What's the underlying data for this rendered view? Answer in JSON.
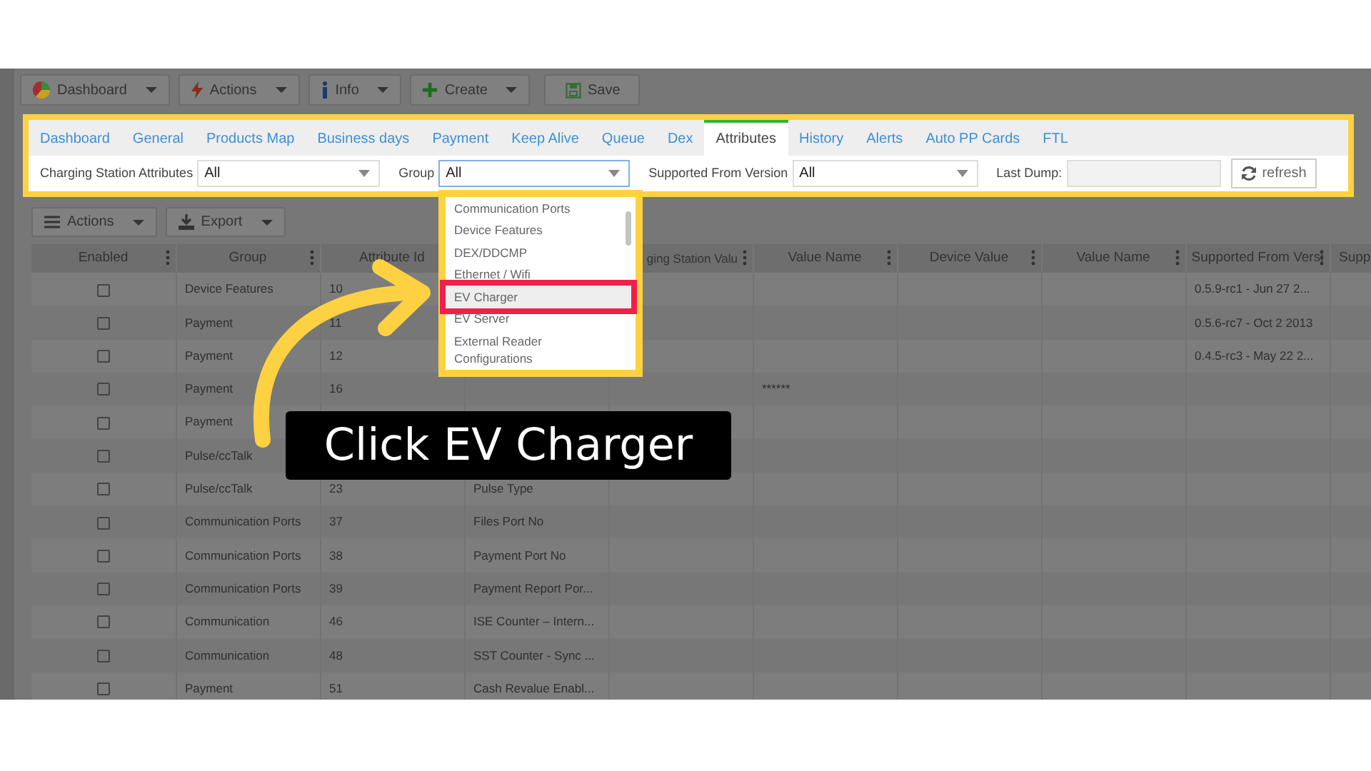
{
  "toolbar": {
    "buttons": [
      {
        "label": "Dashboard",
        "kind": "dropdown"
      },
      {
        "label": "Actions",
        "kind": "dropdown"
      },
      {
        "label": "Info",
        "kind": "dropdown"
      },
      {
        "label": "Create",
        "kind": "dropdown"
      },
      {
        "label": "Save",
        "kind": "plain"
      }
    ]
  },
  "tabs": [
    {
      "label": "Dashboard",
      "selected": false
    },
    {
      "label": "General",
      "selected": false
    },
    {
      "label": "Products Map",
      "selected": false
    },
    {
      "label": "Business days",
      "selected": false
    },
    {
      "label": "Payment",
      "selected": false
    },
    {
      "label": "Keep Alive",
      "selected": false
    },
    {
      "label": "Queue",
      "selected": false
    },
    {
      "label": "Dex",
      "selected": false
    },
    {
      "label": "Attributes",
      "selected": true
    },
    {
      "label": "History",
      "selected": false
    },
    {
      "label": "Alerts",
      "selected": false
    },
    {
      "label": "Auto PP Cards",
      "selected": false
    },
    {
      "label": "FTL",
      "selected": false
    }
  ],
  "filters": [
    {
      "label": "Charging Station Attributes",
      "value": "All",
      "kind": "select",
      "focused": false
    },
    {
      "label": "Group",
      "value": "All",
      "kind": "select",
      "focused": true
    },
    {
      "label": "Supported From Version",
      "value": "All",
      "kind": "select",
      "focused": false
    },
    {
      "label": "Last Dump:",
      "kind": "text"
    }
  ],
  "refresh_button": "refresh",
  "grid_toolbar": [
    "Actions",
    "Export"
  ],
  "table": {
    "columns": [
      "Enabled",
      "Group",
      "Attribute Id",
      null,
      "ging Station Valu",
      "Value Name",
      "Device Value",
      "Value Name",
      "Supported From Versi",
      "Supp"
    ],
    "rows": [
      {
        "enabled": false,
        "group": "Device Features",
        "attribute_id": "10",
        "supported_from_version": "0.5.9-rc1 - Jun 27 2..."
      },
      {
        "enabled": false,
        "group": "Payment",
        "attribute_id": "11",
        "supported_from_version": "0.5.6-rc7 - Oct 2 2013"
      },
      {
        "enabled": false,
        "group": "Payment",
        "attribute_id": "12",
        "supported_from_version": "0.4.5-rc3 - May 22 2..."
      },
      {
        "enabled": false,
        "group": "Payment",
        "attribute_id": "16",
        "value_name": "******"
      },
      {
        "enabled": false,
        "group": "Payment"
      },
      {
        "enabled": false,
        "group": "Pulse/ccTalk"
      },
      {
        "enabled": false,
        "group": "Pulse/ccTalk",
        "attribute_id": "23",
        "column_4": "Pulse Type"
      },
      {
        "enabled": false,
        "group": "Communication Ports",
        "attribute_id": "37",
        "column_4": "Files Port No"
      },
      {
        "enabled": false,
        "group": "Communication Ports",
        "attribute_id": "38",
        "column_4": "Payment Port No"
      },
      {
        "enabled": false,
        "group": "Communication Ports",
        "attribute_id": "39",
        "column_4": "Payment Report Por..."
      },
      {
        "enabled": false,
        "group": "Communication",
        "attribute_id": "46",
        "column_4": "ISE Counter – Intern..."
      },
      {
        "enabled": false,
        "group": "Communication",
        "attribute_id": "48",
        "column_4": "SST Counter - Sync ..."
      },
      {
        "enabled": false,
        "group": "Payment",
        "attribute_id": "51",
        "column_4": "Cash Revalue Enabl..."
      }
    ]
  },
  "group_dropdown": {
    "items": [
      {
        "label": "Communication Ports",
        "selected": false,
        "highlighted": false
      },
      {
        "label": "Device Features",
        "selected": false,
        "highlighted": false
      },
      {
        "label": "DEX/DDCMP",
        "selected": false,
        "highlighted": false
      },
      {
        "label": "Ethernet / Wifi",
        "selected": false,
        "highlighted": false
      },
      {
        "label": "EV Charger",
        "selected": true,
        "highlighted": true
      },
      {
        "label": "EV Server",
        "selected": false,
        "highlighted": false
      },
      {
        "label": "External Reader Configurations",
        "selected": false,
        "highlighted": false
      }
    ]
  },
  "callout": "Click EV Charger"
}
